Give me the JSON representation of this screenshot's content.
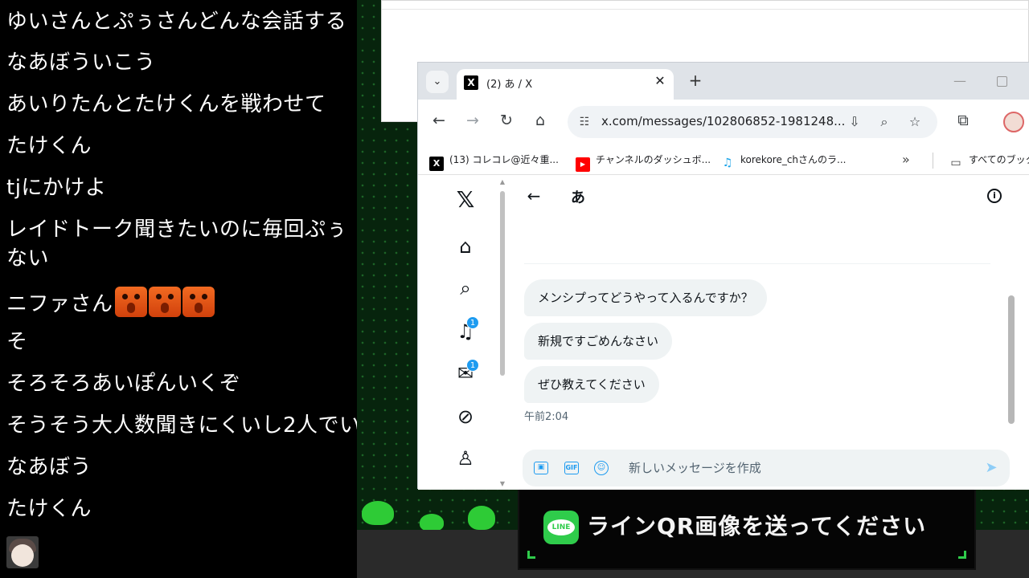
{
  "chat": {
    "lines": [
      "ゆいさんとぷぅさんどんな会話する",
      "なあぼういこう",
      "あいりたんとたけくんを戦わせて",
      "たけくん",
      "tjにかけよ",
      "レイドトーク聞きたいのに毎回ぷぅ",
      "ない",
      "ニファさん",
      "そ",
      "そろそろあいぽんいくぞ",
      "そうそう大人数聞きにくいし2人でい",
      "なあぼう",
      "たけくん"
    ]
  },
  "browser": {
    "tab": {
      "title": "(2) あ / X",
      "favicon": "X"
    },
    "url": "x.com/messages/102806852-1981248...",
    "bookmarks": [
      {
        "label": "(13) コレコレ@近々重...",
        "icon": "x-icon",
        "color": "#000000"
      },
      {
        "label": "チャンネルのダッシュボ...",
        "icon": "youtube-icon",
        "color": "#ff0000"
      },
      {
        "label": "korekore_chさんのラ...",
        "icon": "headset-icon",
        "color": "#1aa3e8"
      },
      {
        "label": "すべてのブック",
        "icon": "folder-icon",
        "color": "#444444"
      }
    ],
    "more_label": "»"
  },
  "x_app": {
    "nav_badges": {
      "notifications": "1",
      "messages": "1"
    },
    "conversation": {
      "title": "あ",
      "messages": [
        "メンシプってどうやって入るんですか？",
        "新規ですごめんなさい",
        "ぜひ教えてください"
      ],
      "timestamp": "午前2:04"
    },
    "composer": {
      "placeholder": "新しいメッセージを作成"
    }
  },
  "overlay": {
    "banner_text": "ラインQR画像を送ってください",
    "line_logo": "LINE"
  },
  "colors": {
    "accent": "#1d9bf0",
    "line_green": "#2fcc4b"
  }
}
